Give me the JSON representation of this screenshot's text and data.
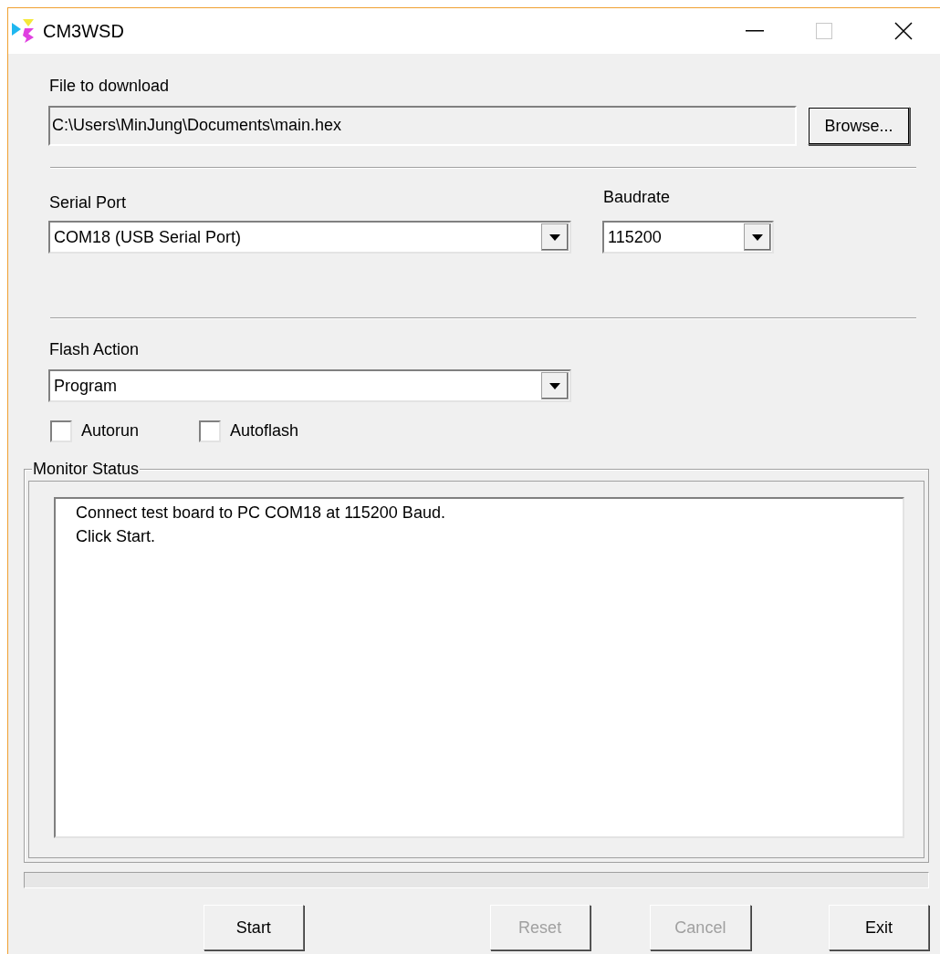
{
  "window": {
    "title": "CM3WSD"
  },
  "file": {
    "label": "File to download",
    "value": "C:\\Users\\MinJung\\Documents\\main.hex",
    "button": "Browse..."
  },
  "serial_port": {
    "label": "Serial Port",
    "value": "COM18 (USB Serial Port)"
  },
  "baudrate": {
    "label": "Baudrate",
    "value": "115200"
  },
  "flash_action": {
    "label": "Flash Action",
    "value": "Program"
  },
  "checkboxes": [
    {
      "label": "Autorun",
      "checked": false
    },
    {
      "label": "Autoflash",
      "checked": false
    }
  ],
  "monitor": {
    "title": "Monitor Status",
    "lines": [
      "Connect test board to PC COM18 at 115200 Baud.",
      "Click Start."
    ]
  },
  "buttons": [
    {
      "label": "Start",
      "disabled": false
    },
    {
      "label": "Reset",
      "disabled": true
    },
    {
      "label": "Cancel",
      "disabled": true
    },
    {
      "label": "Exit",
      "disabled": false
    }
  ]
}
